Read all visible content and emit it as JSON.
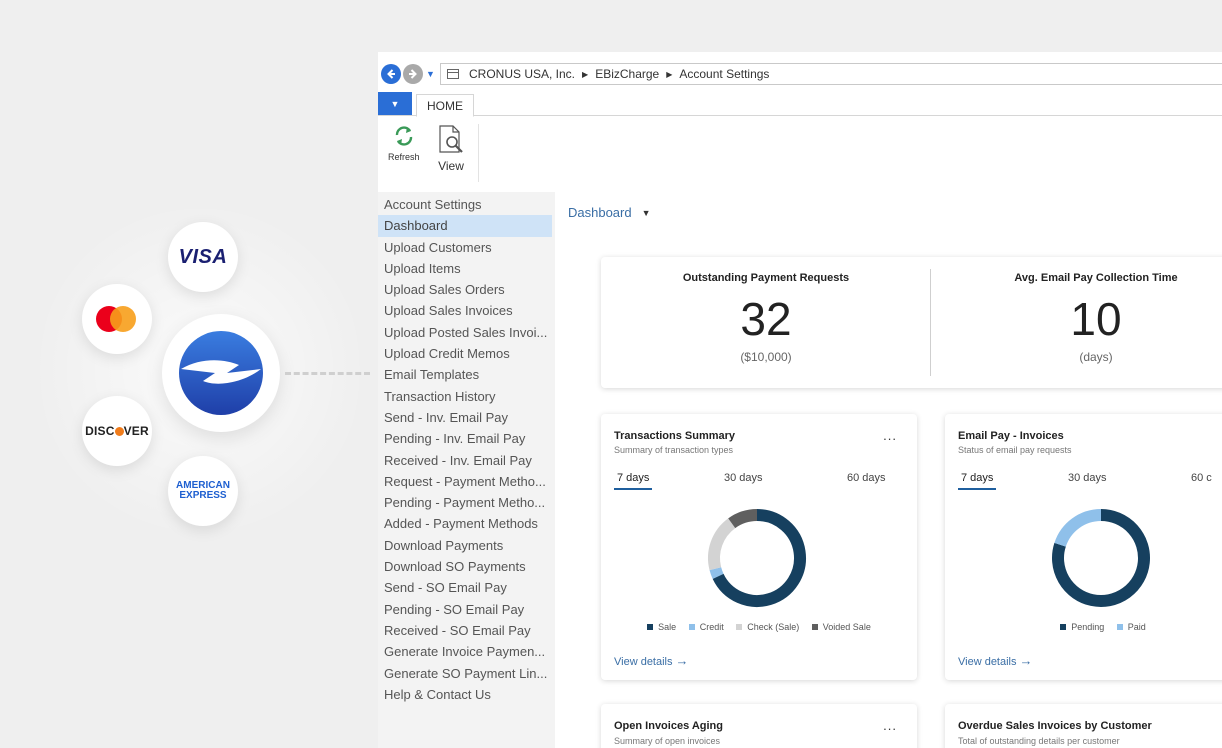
{
  "address": {
    "company": "CRONUS USA, Inc.",
    "module": "EBizCharge",
    "page": "Account Settings"
  },
  "ribbon": {
    "tab_home": "HOME",
    "refresh_label": "Refresh",
    "view_label": "View"
  },
  "sidebar": {
    "items": [
      {
        "label": "Account Settings"
      },
      {
        "label": "Dashboard"
      },
      {
        "label": "Upload Customers"
      },
      {
        "label": "Upload Items"
      },
      {
        "label": "Upload Sales Orders"
      },
      {
        "label": "Upload Sales Invoices"
      },
      {
        "label": "Upload Posted Sales Invoi..."
      },
      {
        "label": "Upload Credit Memos"
      },
      {
        "label": "Email Templates"
      },
      {
        "label": "Transaction History"
      },
      {
        "label": "Send - Inv. Email Pay"
      },
      {
        "label": "Pending - Inv. Email Pay"
      },
      {
        "label": "Received - Inv. Email Pay"
      },
      {
        "label": "Request - Payment Metho..."
      },
      {
        "label": "Pending - Payment Metho..."
      },
      {
        "label": "Added - Payment Methods"
      },
      {
        "label": "Download Payments"
      },
      {
        "label": "Download SO Payments"
      },
      {
        "label": "Send - SO Email Pay"
      },
      {
        "label": "Pending - SO Email Pay"
      },
      {
        "label": "Received - SO Email Pay"
      },
      {
        "label": "Generate Invoice Paymen..."
      },
      {
        "label": "Generate SO Payment Lin..."
      },
      {
        "label": "Help & Contact Us"
      }
    ]
  },
  "main": {
    "view_selector": "Dashboard",
    "kpis": [
      {
        "title": "Outstanding Payment Requests",
        "value": "32",
        "sub": "($10,000)"
      },
      {
        "title": "Avg. Email Pay Collection Time",
        "value": "10",
        "sub": "(days)"
      }
    ],
    "panels": [
      {
        "title": "Transactions Summary",
        "subtitle": "Summary of transaction types",
        "more": "...",
        "tabs": [
          "7 days",
          "30 days",
          "60 days"
        ],
        "legend": [
          "Sale",
          "Credit",
          "Check (Sale)",
          "Voided Sale"
        ],
        "link": "View details"
      },
      {
        "title": "Email Pay - Invoices",
        "subtitle": "Status of email pay requests",
        "more": "...",
        "tabs": [
          "7 days",
          "30 days",
          "60 c"
        ],
        "legend": [
          "Pending",
          "Paid"
        ],
        "link": "View details"
      },
      {
        "title": "Open Invoices Aging",
        "subtitle": "Summary of open invoices",
        "more": "..."
      },
      {
        "title": "Overdue Sales Invoices by Customer",
        "subtitle": "Total of outstanding details per customer"
      }
    ]
  },
  "logos": {
    "visa": "VISA",
    "discover_a": "DISC",
    "discover_b": "VER",
    "amex_line1": "AMERICAN",
    "amex_line2": "EXPRESS"
  },
  "chart_data": [
    {
      "type": "pie",
      "title": "Transactions Summary",
      "categories": [
        "Sale",
        "Credit",
        "Check (Sale)",
        "Voided Sale"
      ],
      "values": [
        68,
        3,
        19,
        10
      ],
      "colors": [
        "#16405f",
        "#8fc0ea",
        "#d3d3d3",
        "#5f5f5f"
      ]
    },
    {
      "type": "pie",
      "title": "Email Pay - Invoices",
      "categories": [
        "Pending",
        "Paid"
      ],
      "values": [
        80,
        20
      ],
      "colors": [
        "#16405f",
        "#8fc0ea"
      ]
    }
  ]
}
